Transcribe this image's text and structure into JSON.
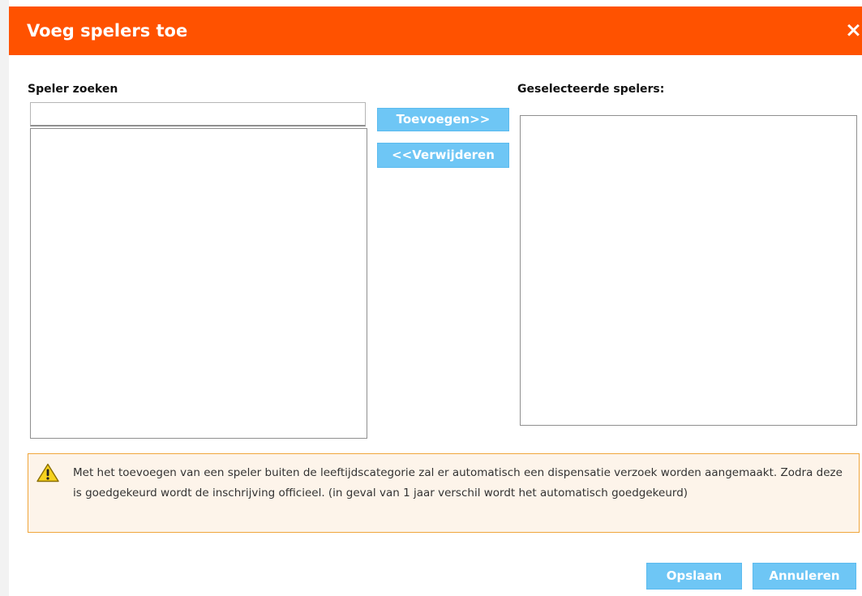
{
  "dialog": {
    "title": "Voeg spelers toe",
    "close_glyph": "×",
    "header_color": "#ff5200"
  },
  "search": {
    "label": "Speler zoeken",
    "value": "",
    "placeholder": ""
  },
  "selected": {
    "label": "Geselecteerde spelers:"
  },
  "actions": {
    "add_label": "Toevoegen>>",
    "remove_label": "<<Verwijderen",
    "save_label": "Opslaan",
    "cancel_label": "Annuleren",
    "button_color": "#6ec6f5"
  },
  "warning": {
    "icon": "warning-triangle-icon",
    "text": "Met het toevoegen van een speler buiten de leeftijdscategorie zal er automatisch een dispensatie verzoek worden aangemaakt. Zodra deze is goedgekeurd wordt de inschrijving officieel. (in geval van 1 jaar verschil wordt het automatisch goedgekeurd)",
    "border_color": "#f0a63c",
    "background_color": "#fdf4ea"
  }
}
